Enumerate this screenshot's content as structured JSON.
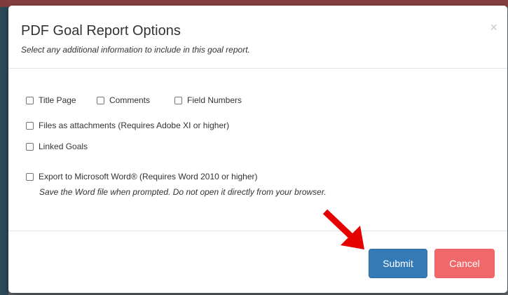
{
  "dialog": {
    "title": "PDF Goal Report Options",
    "subtitle": "Select any additional information to include in this goal report.",
    "close_symbol": "×"
  },
  "options": {
    "title_page": {
      "label": "Title Page",
      "checked": false
    },
    "comments": {
      "label": "Comments",
      "checked": false
    },
    "field_numbers": {
      "label": "Field Numbers",
      "checked": false
    },
    "files_attachments": {
      "label": "Files as attachments (Requires Adobe XI or higher)",
      "checked": false
    },
    "linked_goals": {
      "label": "Linked Goals",
      "checked": false
    },
    "export_word": {
      "label": "Export to Microsoft Word® (Requires Word 2010 or higher)",
      "hint": "Save the Word file when prompted. Do not open it directly from your browser.",
      "checked": false
    }
  },
  "footer": {
    "submit_label": "Submit",
    "cancel_label": "Cancel"
  },
  "colors": {
    "submit": "#337ab7",
    "cancel": "#f0686a",
    "annotation_arrow": "#e60000"
  },
  "icons": {
    "close": "close-icon",
    "annotation": "red-arrow-icon"
  }
}
